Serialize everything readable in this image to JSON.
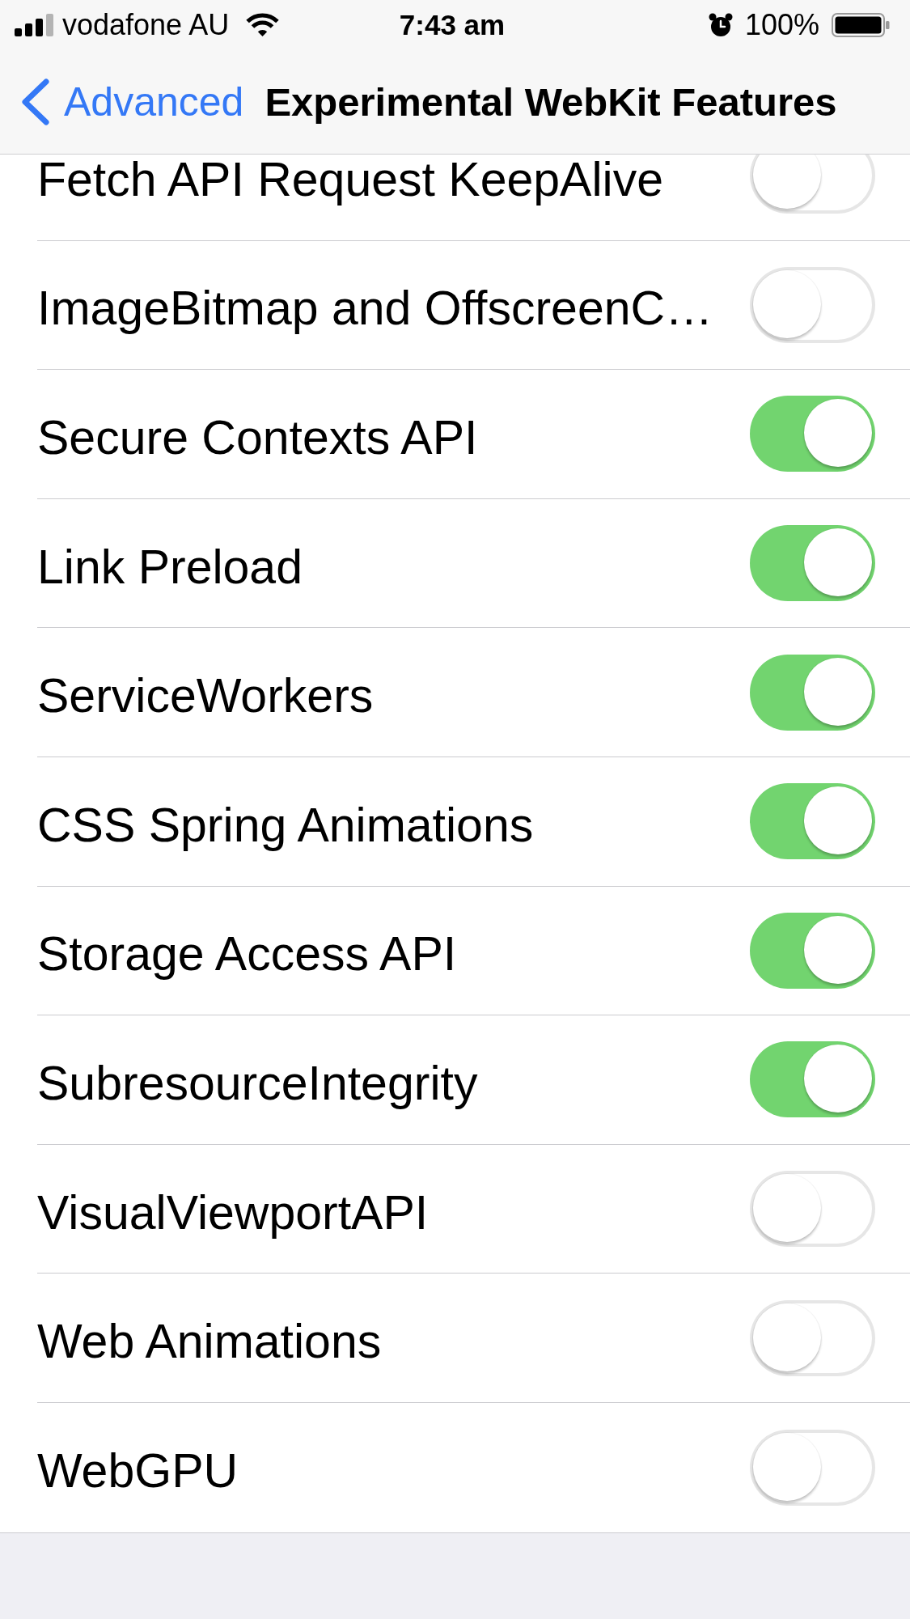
{
  "status_bar": {
    "carrier": "vodafone AU",
    "time": "7:43 am",
    "battery": "100%"
  },
  "nav_bar": {
    "back": "Advanced",
    "title": "Experimental WebKit Features"
  },
  "rows": [
    {
      "label": "Fetch API Request KeepAlive",
      "on": false
    },
    {
      "label": "ImageBitmap and OffscreenC…",
      "on": false
    },
    {
      "label": "Secure Contexts API",
      "on": true
    },
    {
      "label": "Link Preload",
      "on": true
    },
    {
      "label": "ServiceWorkers",
      "on": true
    },
    {
      "label": "CSS Spring Animations",
      "on": true
    },
    {
      "label": "Storage Access API",
      "on": true
    },
    {
      "label": "SubresourceIntegrity",
      "on": true
    },
    {
      "label": "VisualViewportAPI",
      "on": false
    },
    {
      "label": "Web Animations",
      "on": false
    },
    {
      "label": "WebGPU",
      "on": false
    }
  ]
}
